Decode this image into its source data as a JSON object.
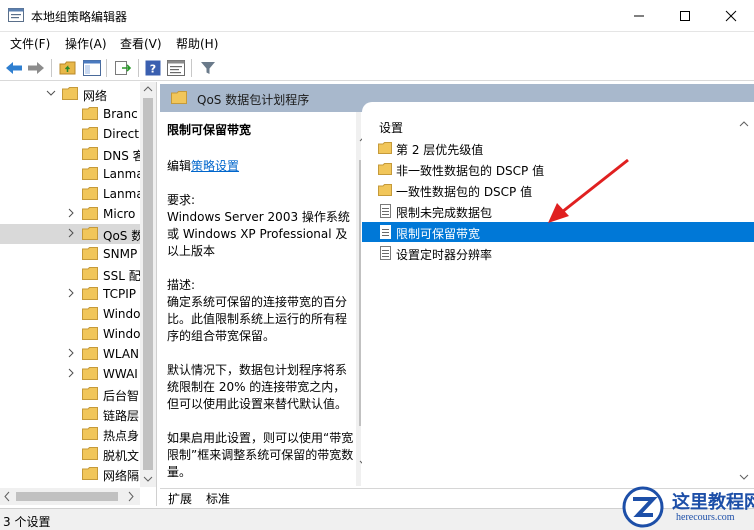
{
  "window": {
    "title": "本地组策略编辑器"
  },
  "menu": [
    "文件(F)",
    "操作(A)",
    "查看(V)",
    "帮助(H)"
  ],
  "tree": {
    "items": [
      {
        "label": "网络",
        "indent": 1,
        "expanded": true,
        "selected": false,
        "has_children": true
      },
      {
        "label": "Branc",
        "indent": 2,
        "expanded": false,
        "selected": false,
        "has_children": false
      },
      {
        "label": "Direct",
        "indent": 2,
        "expanded": false,
        "selected": false,
        "has_children": false
      },
      {
        "label": "DNS 客",
        "indent": 2,
        "expanded": false,
        "selected": false,
        "has_children": false
      },
      {
        "label": "Lanma",
        "indent": 2,
        "expanded": false,
        "selected": false,
        "has_children": false
      },
      {
        "label": "Lanma",
        "indent": 2,
        "expanded": false,
        "selected": false,
        "has_children": false
      },
      {
        "label": "Micro",
        "indent": 2,
        "expanded": false,
        "selected": false,
        "has_children": true
      },
      {
        "label": "QoS 数",
        "indent": 2,
        "expanded": false,
        "selected": true,
        "has_children": true
      },
      {
        "label": "SNMP",
        "indent": 2,
        "expanded": false,
        "selected": false,
        "has_children": false
      },
      {
        "label": "SSL 配",
        "indent": 2,
        "expanded": false,
        "selected": false,
        "has_children": false
      },
      {
        "label": "TCPIP",
        "indent": 2,
        "expanded": false,
        "selected": false,
        "has_children": true
      },
      {
        "label": "Windo",
        "indent": 2,
        "expanded": false,
        "selected": false,
        "has_children": false
      },
      {
        "label": "Windo",
        "indent": 2,
        "expanded": false,
        "selected": false,
        "has_children": false
      },
      {
        "label": "WLAN",
        "indent": 2,
        "expanded": false,
        "selected": false,
        "has_children": true
      },
      {
        "label": "WWAI",
        "indent": 2,
        "expanded": false,
        "selected": false,
        "has_children": true
      },
      {
        "label": "后台智",
        "indent": 2,
        "expanded": false,
        "selected": false,
        "has_children": false
      },
      {
        "label": "链路层",
        "indent": 2,
        "expanded": false,
        "selected": false,
        "has_children": false
      },
      {
        "label": "热点身",
        "indent": 2,
        "expanded": false,
        "selected": false,
        "has_children": false
      },
      {
        "label": "脱机文",
        "indent": 2,
        "expanded": false,
        "selected": false,
        "has_children": false
      },
      {
        "label": "网络隔",
        "indent": 2,
        "expanded": false,
        "selected": false,
        "has_children": false
      }
    ]
  },
  "header": {
    "title": "QoS 数据包计划程序"
  },
  "description": {
    "title": "限制可保留带宽",
    "edit_prefix": "编辑",
    "edit_link": "策略设置",
    "requirements_label": "要求:",
    "requirements": [
      "Windows Server 2003 操作系统",
      "或 Windows XP Professional 及",
      "以上版本"
    ],
    "desc_label": "描述:",
    "desc_lines": [
      "确定系统可保留的连接带宽的百分",
      "比。此值限制系统上运行的所有程",
      "序的组合带宽保留。"
    ],
    "default_lines": [
      "默认情况下，数据包计划程序将系",
      "统限制在 20% 的连接带宽之内，",
      "但可以使用此设置来替代默认值。"
    ],
    "enable_lines": [
      "如果启用此设置，则可以使用“带宽",
      "限制”框来调整系统可保留的带宽数",
      "量。"
    ]
  },
  "settings": {
    "column_header": "设置",
    "items": [
      {
        "label": "第 2 层优先级值",
        "type": "folder",
        "selected": false
      },
      {
        "label": "非一致性数据包的 DSCP 值",
        "type": "folder",
        "selected": false
      },
      {
        "label": "一致性数据包的 DSCP 值",
        "type": "folder",
        "selected": false
      },
      {
        "label": "限制未完成数据包",
        "type": "policy",
        "selected": false
      },
      {
        "label": "限制可保留带宽",
        "type": "policy",
        "selected": true
      },
      {
        "label": "设置定时器分辨率",
        "type": "policy",
        "selected": false
      }
    ]
  },
  "tabs": [
    "扩展",
    "标准"
  ],
  "status": {
    "text": "3 个设置"
  },
  "watermark": {
    "title": "这里教程网",
    "url": "herecours.com"
  },
  "colors": {
    "selection": "#0078d7",
    "header_band": "#a8b8cc",
    "folder": "#e8b84a",
    "annotation_arrow": "#e02020",
    "link": "#0066cc"
  }
}
